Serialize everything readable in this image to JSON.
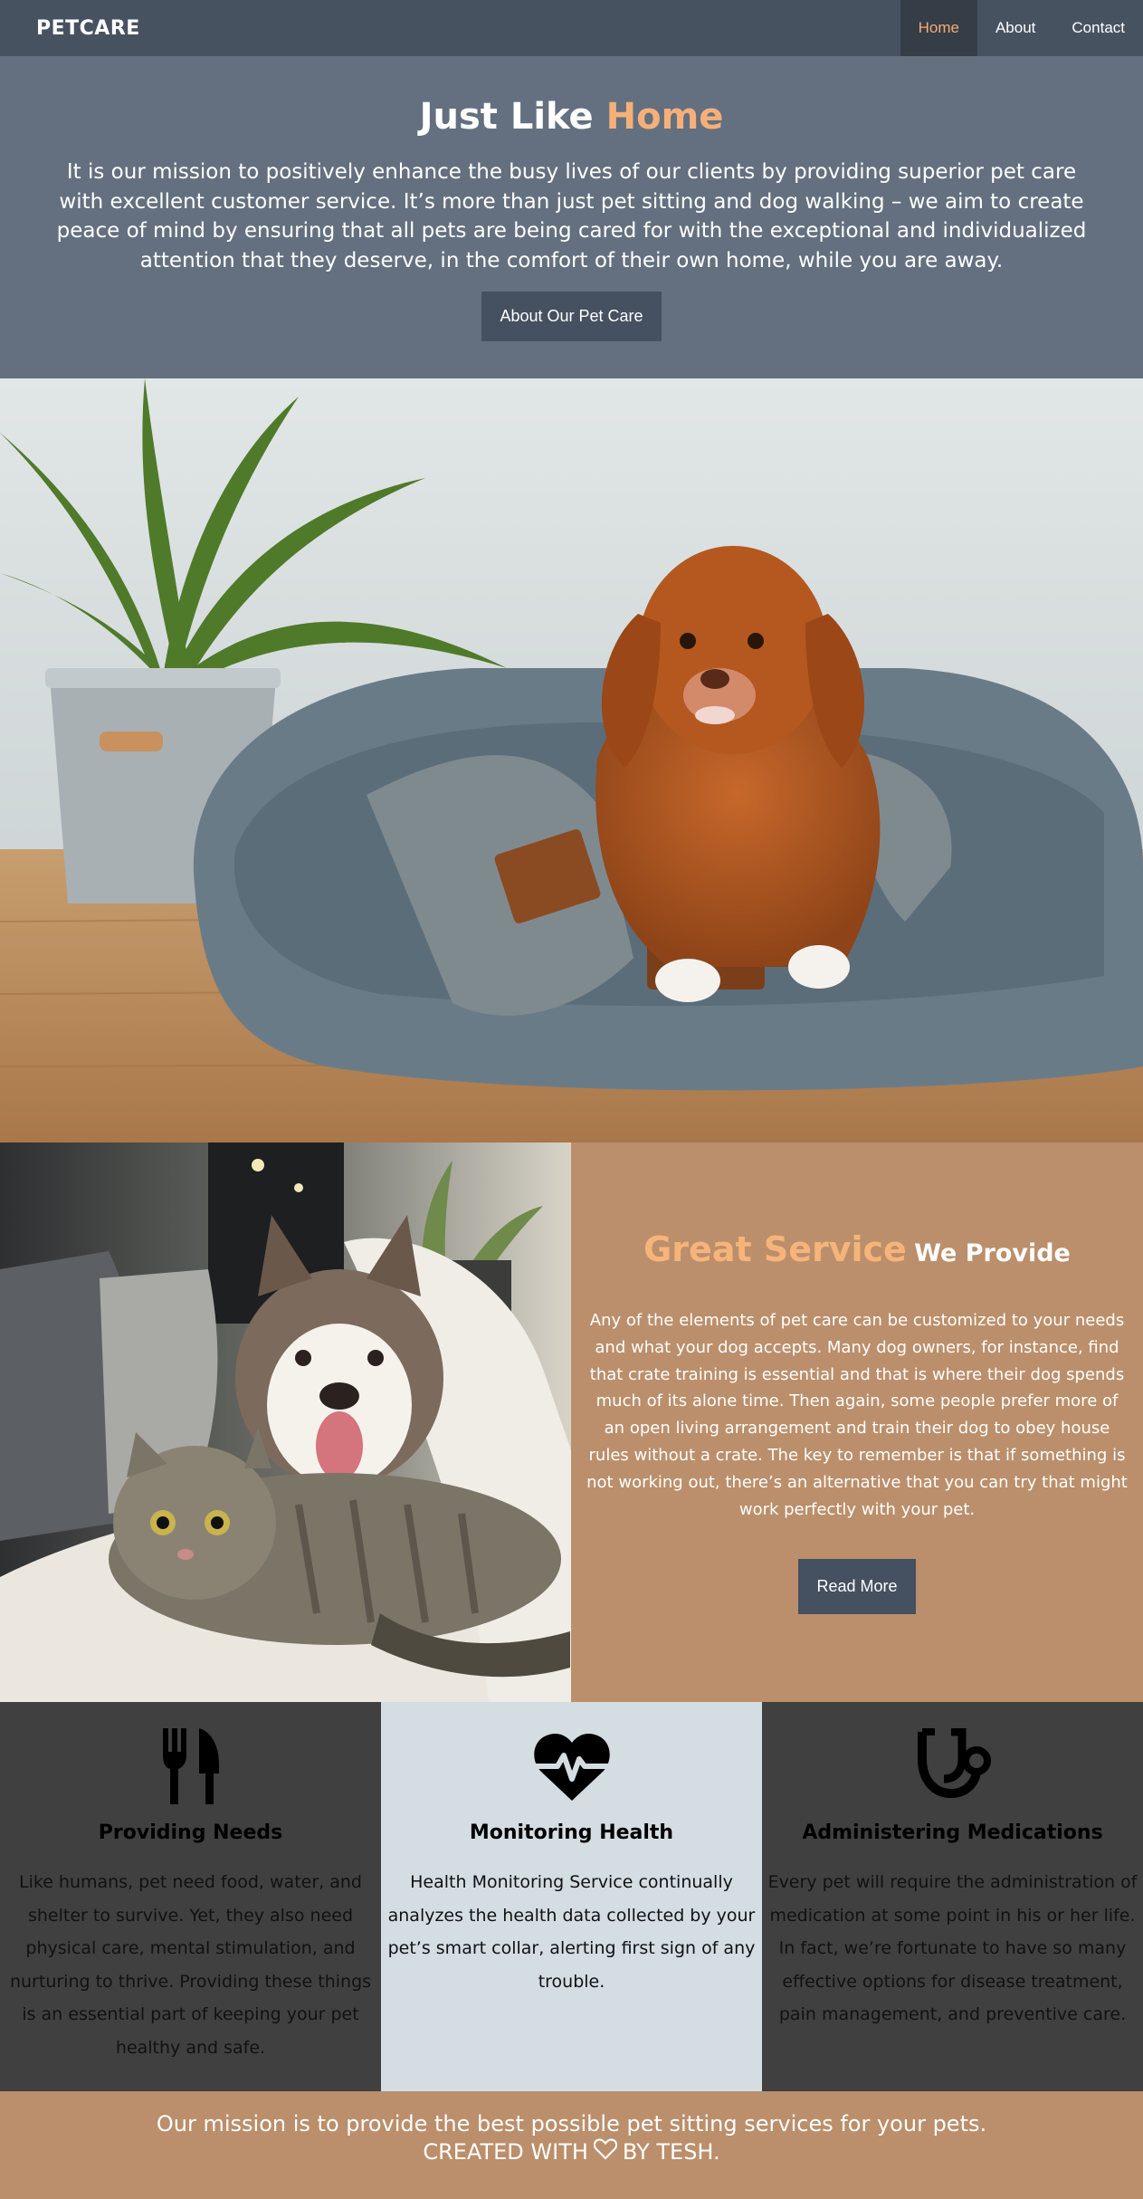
{
  "nav": {
    "brand": "PETCARE",
    "links": [
      {
        "label": "Home",
        "active": true
      },
      {
        "label": "About",
        "active": false
      },
      {
        "label": "Contact",
        "active": false
      }
    ]
  },
  "hero": {
    "title_part1": "Just Like",
    "title_accent": "Home",
    "body": "It is our mission to positively enhance the busy lives of our clients by providing superior pet care with excellent customer service. It’s more than just pet sitting and dog walking – we aim to create peace of mind by ensuring that all pets are being cared for with the exceptional and individualized attention that they deserve, in the comfort of their own home, while you are away.",
    "button_label": "About Our Pet Care"
  },
  "service": {
    "title_big": "Great Service",
    "title_small": "We Provide",
    "body": "Any of the elements of pet care can be customized to your needs and what your dog accepts. Many dog owners, for instance, find that crate training is essential and that is where their dog spends much of its alone time. Then again, some people prefer more of an open living arrangement and train their dog to obey house rules without a crate. The key to remember is that if something is not working out, there’s an alternative that you can try that might work perfectly with your pet.",
    "button_label": "Read More"
  },
  "features": [
    {
      "icon": "fork-knife-icon",
      "title": "Providing Needs",
      "body": "Like humans, pet need food, water, and shelter to survive. Yet, they also need physical care, mental stimulation, and nurturing to thrive. Providing these things is an essential part of keeping your pet healthy and safe."
    },
    {
      "icon": "heartbeat-icon",
      "title": "Monitoring Health",
      "body": "Health Monitoring Service continually analyzes the health data collected by your pet’s smart collar, alerting first sign of any trouble."
    },
    {
      "icon": "stethoscope-icon",
      "title": "Administering Medications",
      "body": "Every pet will require the administration of medication at some point in his or her life. In fact, we’re fortunate to have so many effective options for disease treatment, pain management, and preventive care."
    }
  ],
  "footer": {
    "mission": "Our mission is to provide the best possible pet sitting services for your pets.",
    "credit_before": "CREATED WITH",
    "credit_after": "BY TESH.",
    "credit_icon": "heart-outline-icon"
  },
  "colors": {
    "nav_bg": "#475261",
    "hero_bg": "#64707f",
    "accent": "#f5b07a",
    "tan": "#bb8f6b",
    "feature_dark": "#404040",
    "feature_light": "#d3dde2"
  }
}
